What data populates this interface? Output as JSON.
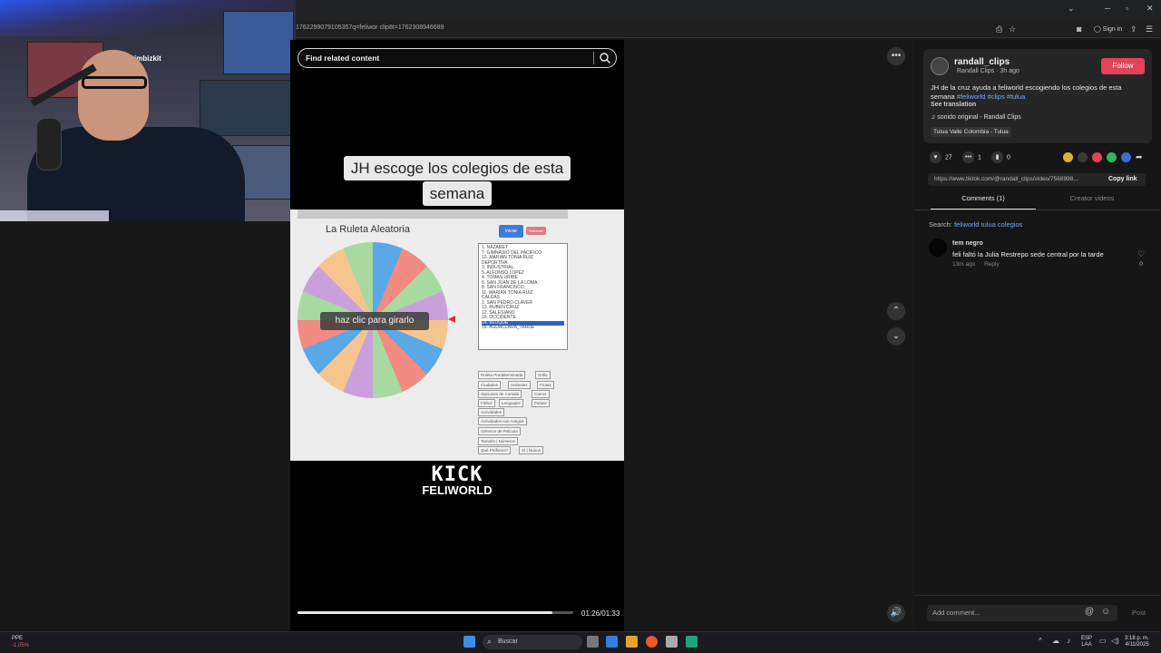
{
  "browser": {
    "url": "1762299079105357q=feliwor clip8t=1762308946689",
    "sign_in": "Sign in",
    "window_controls": [
      "⌄",
      "─",
      "▫",
      "✕"
    ]
  },
  "webcam": {
    "poster_label": "imbizkit"
  },
  "video": {
    "search_placeholder": "Find related content",
    "caption_line1": "JH escoge los colegios de esta",
    "caption_line2": "semana",
    "wheel_title": "La Ruleta Aleatoria",
    "start_button": "Iniciar",
    "reset_button": "Reiniciar",
    "spin_label": "haz clic para girarlo",
    "list_items": [
      "1. NAZARET",
      "7. GIMNASIO DEL PACIFICO",
      "10. MARIAN TONIA RUIZ",
      "DEPORTIVA",
      "3. INDUSTRIAL",
      "5. ALFONSO LOPEZ",
      "4. TOMAS URIBE",
      "6. SAN JUAN DE LA LOMA",
      "8. SAN FRANCISCO",
      "11. MARIAN TONIA RUIZ",
      "CALDAS",
      "2. SAN PEDRO CLAVER",
      "13. RUBEN CRUZ",
      "12. SALESIANO",
      "15. OCCIDENTE",
      "14. BLOQUE",
      "16. AGUACLARA_TARDE"
    ],
    "highlighted_item": "14. BLOQUE",
    "chips": [
      "Ruleta Predeterminada",
      "Grillo",
      "Ciudades",
      "Animales",
      "Frutas",
      "Opciones de Comida",
      "Carros",
      "Fútbol",
      "Lenguajes",
      "Países",
      "Actividades",
      "Actividades con Amigos",
      "Géneros de Película",
      "Tamaño | Números",
      "Qué Prefieres?",
      "Sí | Nunca"
    ],
    "kick_line1": "KICK",
    "kick_line2": "FELIWORLD",
    "timecode": "01:26/01:33",
    "progress": 0.925
  },
  "panel": {
    "username": "randall_clips",
    "subline": "Randall Clips · 3h ago",
    "follow_label": "Follow",
    "description_text": "JH de la cruz ayuda a feliworld escogiendo los colegios de esta semana",
    "hashtags": "#feliworld #clips #tulua",
    "see_translation": "See translation",
    "sound": "sonido original - Randall Clips",
    "location": "Tulua Valle Colombia - Tulua",
    "likes": "27",
    "comments_count": "1",
    "saves": "0",
    "link": "https://www.tiktok.com/@randall_clips/video/7568998...",
    "copy_link": "Copy link",
    "tab_comments": "Comments (1)",
    "tab_creator": "Creator videos",
    "search_prefix": "Search:",
    "search_query": "feliworld tulua colegios",
    "comment": {
      "user": "tem negro",
      "text": "feli faltó la Julia Restrepo sede central por la tarde",
      "time": "13m ago",
      "reply": "Reply",
      "likes": "0"
    },
    "add_comment_placeholder": "Add comment...",
    "post_label": "Post"
  },
  "taskbar": {
    "weather_name": "PPE",
    "weather_change": "-1,05%",
    "search_label": "Buscar",
    "lang1": "ESP",
    "lang2": "LAA",
    "time": "3:18 p. m.",
    "date": "4/11/2025"
  },
  "colors": {
    "accent": "#e0435a",
    "link": "#6ea9ff"
  }
}
